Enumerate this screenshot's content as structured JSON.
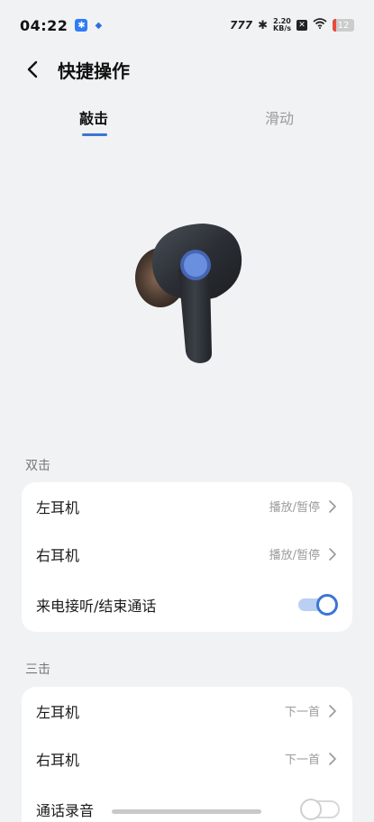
{
  "status_bar": {
    "time": "04:22",
    "net_speed_value": "2.20",
    "net_speed_unit": "KB/s",
    "battery_level": "12"
  },
  "header": {
    "title": "快捷操作"
  },
  "tabs": [
    {
      "label": "敲击",
      "active": true
    },
    {
      "label": "滑动",
      "active": false
    }
  ],
  "sections": [
    {
      "label": "双击",
      "rows": [
        {
          "title": "左耳机",
          "value": "播放/暂停"
        },
        {
          "title": "右耳机",
          "value": "播放/暂停"
        },
        {
          "title": "来电接听/结束通话",
          "toggle": true
        }
      ]
    },
    {
      "label": "三击",
      "rows": [
        {
          "title": "左耳机",
          "value": "下一首"
        },
        {
          "title": "右耳机",
          "value": "下一首"
        },
        {
          "title": "通话录音",
          "toggle": false
        }
      ]
    }
  ],
  "colors": {
    "accent": "#3b75d6",
    "background": "#f1f2f4"
  }
}
